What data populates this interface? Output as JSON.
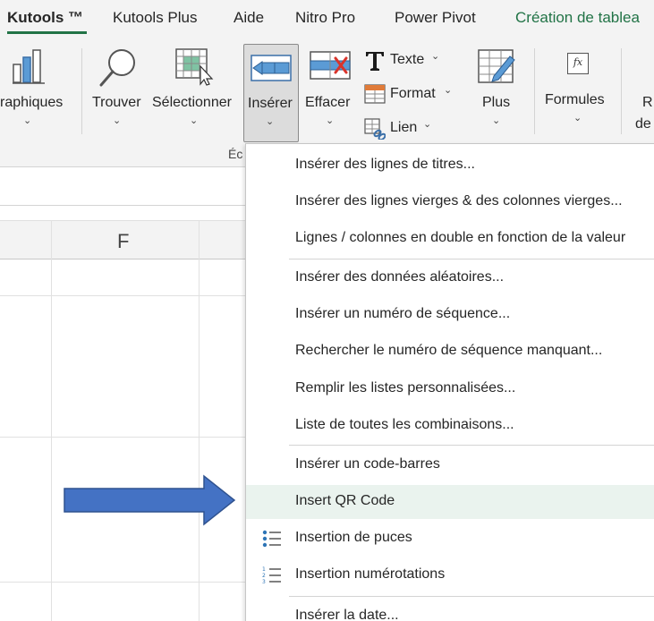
{
  "tabs": [
    {
      "label": "Kutools ™",
      "active": true
    },
    {
      "label": "Kutools Plus",
      "active": false
    },
    {
      "label": "Aide",
      "active": false
    },
    {
      "label": "Nitro Pro",
      "active": false
    },
    {
      "label": "Power Pivot",
      "active": false
    },
    {
      "label": "Création de tablea",
      "active": false,
      "color": "#217346"
    }
  ],
  "ribbon": {
    "graphiques_label": "raphiques",
    "trouver_label": "Trouver",
    "selectionner_label": "Sélectionner",
    "inserer_label": "Insérer",
    "effacer_label": "Effacer",
    "texte_label": "Texte",
    "format_label": "Format",
    "lien_label": "Lien",
    "plus_label": "Plus",
    "formules_label": "Formules",
    "formules_icon_text": "fx",
    "partial_label_1": "R",
    "partial_label_2": "de",
    "group_label": "Éc",
    "chevron": "⌄",
    "small_chevron": "⌄"
  },
  "grid": {
    "column_letter": "F"
  },
  "menu": {
    "items": [
      {
        "label": "Insérer des lignes de titres...",
        "icon": ""
      },
      {
        "label": "Insérer des lignes vierges & des colonnes vierges...",
        "icon": ""
      },
      {
        "label": "Lignes / colonnes en double en fonction de la valeur",
        "icon": ""
      },
      {
        "label": "Insérer des données aléatoires...",
        "icon": ""
      },
      {
        "label": "Insérer un numéro de séquence...",
        "icon": ""
      },
      {
        "label": "Rechercher le numéro de séquence manquant...",
        "icon": ""
      },
      {
        "label": "Remplir les listes personnalisées...",
        "icon": ""
      },
      {
        "label": "Liste de toutes les combinaisons...",
        "icon": ""
      },
      {
        "label": "Insérer un code-barres",
        "icon": ""
      },
      {
        "label": "Insert QR Code",
        "icon": "",
        "hover": true
      },
      {
        "label": "Insertion de puces",
        "icon": "bullet-list-icon"
      },
      {
        "label": "Insertion numérotations",
        "icon": "numbered-list-icon"
      },
      {
        "label": "Insérer la date...",
        "icon": ""
      }
    ],
    "numbered_icon_digits": [
      "1",
      "2",
      "3"
    ]
  },
  "colors": {
    "accent": "#217346",
    "arrow": "#4472c4",
    "hover": "#eaf3ee"
  }
}
